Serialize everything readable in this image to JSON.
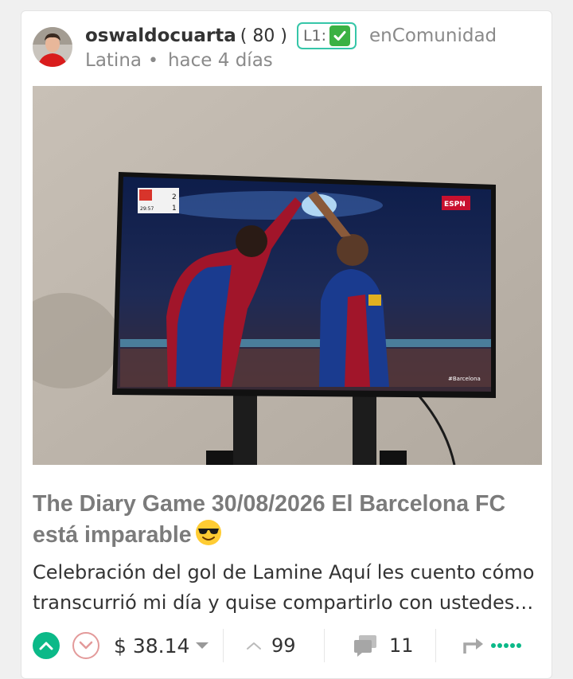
{
  "post": {
    "author": {
      "username": "oswaldocuarta",
      "reputation": "( 80 )",
      "level_label": "L1:",
      "level_check": "✅"
    },
    "community_prefix": "enComunidad",
    "community_name": "Latina",
    "separator": "•",
    "time_ago": "hace 4 días",
    "title": "The Diary Game 30/08/2026 El Barcelona FC está imparable",
    "title_emoji": "smiling-face-with-sunglasses",
    "excerpt": "Celebración del gol de Lamine Aquí les cuento cómo transcurrió mi día y quise compartirlo con ustedes…",
    "image_alt": "TV showing Barcelona players celebrating a goal",
    "tv_overlay": {
      "network": "ESPN",
      "score_home": "2",
      "score_away": "1",
      "clock": "29:57",
      "hashtag": "#Barcelona"
    }
  },
  "footer": {
    "payout": "$ 38.14",
    "votes_count": "99",
    "comments_count": "11"
  },
  "colors": {
    "accent": "#0bb988",
    "downvote": "#e39a9a",
    "badge_border": "#36c6a8",
    "title": "#7b7b7b"
  },
  "icons": {
    "upvote": "chevron-up-icon",
    "downvote": "chevron-down-icon",
    "payout_dropdown": "caret-down-icon",
    "votes": "chevron-up-icon",
    "comments": "comment-bubbles-icon",
    "share": "share-arrow-icon",
    "more": "more-dots-icon"
  }
}
